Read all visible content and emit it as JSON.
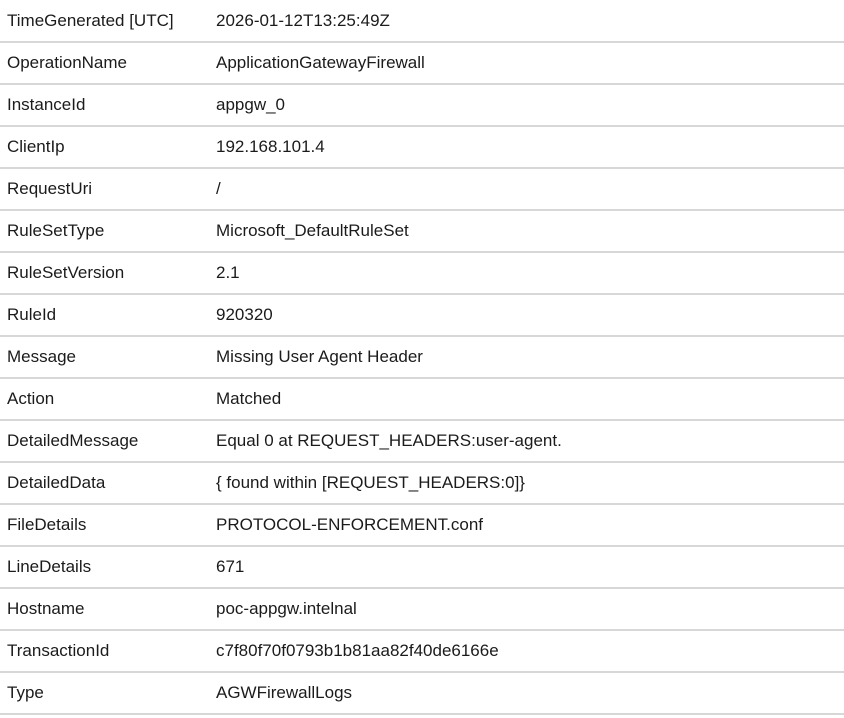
{
  "details": {
    "rows": [
      {
        "field": "TimeGenerated [UTC]",
        "value": "2026-01-12T13:25:49Z"
      },
      {
        "field": "OperationName",
        "value": "ApplicationGatewayFirewall"
      },
      {
        "field": "InstanceId",
        "value": "appgw_0"
      },
      {
        "field": "ClientIp",
        "value": "192.168.101.4"
      },
      {
        "field": "RequestUri",
        "value": "/"
      },
      {
        "field": "RuleSetType",
        "value": "Microsoft_DefaultRuleSet"
      },
      {
        "field": "RuleSetVersion",
        "value": "2.1"
      },
      {
        "field": "RuleId",
        "value": "920320"
      },
      {
        "field": "Message",
        "value": "Missing User Agent Header"
      },
      {
        "field": "Action",
        "value": "Matched"
      },
      {
        "field": "DetailedMessage",
        "value": "Equal 0 at REQUEST_HEADERS:user-agent."
      },
      {
        "field": "DetailedData",
        "value": "{ found within [REQUEST_HEADERS:0]}"
      },
      {
        "field": "FileDetails",
        "value": "PROTOCOL-ENFORCEMENT.conf"
      },
      {
        "field": "LineDetails",
        "value": "671"
      },
      {
        "field": "Hostname",
        "value": "poc-appgw.intelnal"
      },
      {
        "field": "TransactionId",
        "value": "c7f80f70f0793b1b81aa82f40de6166e"
      },
      {
        "field": "Type",
        "value": "AGWFirewallLogs"
      }
    ]
  }
}
